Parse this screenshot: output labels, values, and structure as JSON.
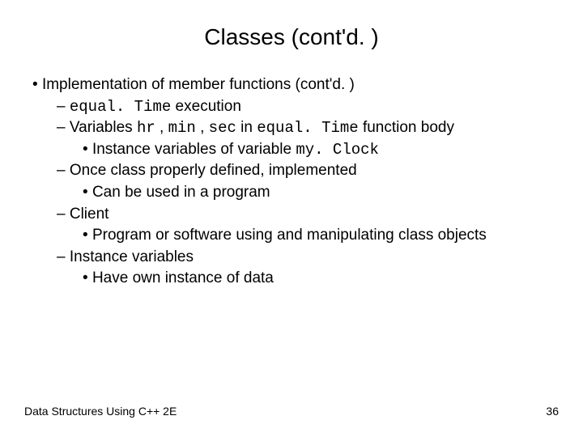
{
  "title": "Classes (cont'd. )",
  "bullet1": "Implementation of member functions (cont'd. )",
  "sub1_prefix": "",
  "sub1_code": "equal. Time",
  "sub1_suffix": " execution",
  "sub2_prefix": "Variables ",
  "sub2_code1": "hr",
  "sub2_mid1": " , ",
  "sub2_code2": "min",
  "sub2_mid2": " , ",
  "sub2_code3": "sec",
  "sub2_mid3": " in ",
  "sub2_code4": "equal. Time",
  "sub2_suffix": "  function body",
  "sub2a_prefix": "Instance variables of variable ",
  "sub2a_code": "my. Clock",
  "sub3": "Once class properly defined, implemented",
  "sub3a": "Can be used in a program",
  "sub4": "Client",
  "sub4a": "Program or software using and manipulating class objects",
  "sub5": "Instance variables",
  "sub5a": "Have own instance of data",
  "footer_left": "Data Structures Using C++ 2E",
  "footer_right": "36"
}
